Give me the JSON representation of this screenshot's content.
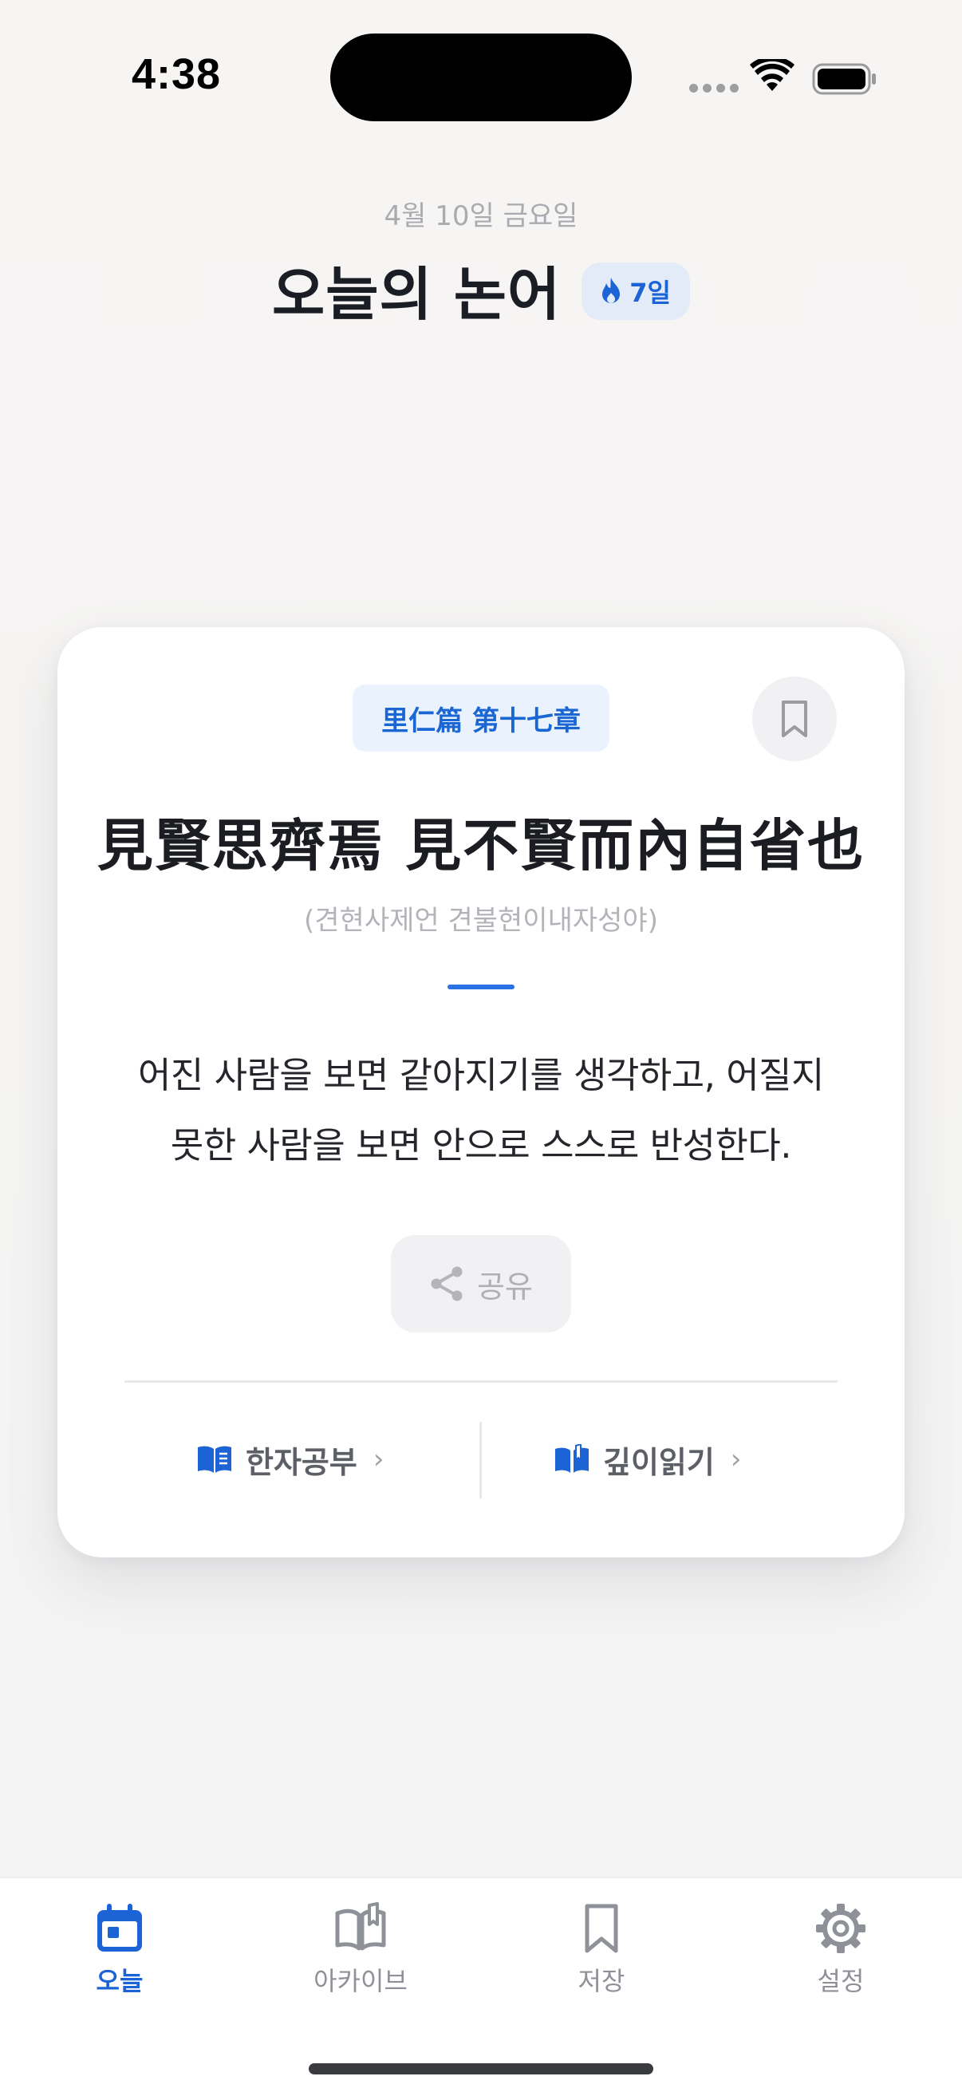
{
  "status_bar": {
    "time": "4:38"
  },
  "header": {
    "date": "4월 10일 금요일",
    "title": "오늘의 논어",
    "streak_label": "7일"
  },
  "card": {
    "chapter": "里仁篇 第十七章",
    "hanja": "見賢思齊焉 見不賢而內自省也",
    "reading": "(견현사제언 견불현이내자성야)",
    "translation": "어진 사람을 보면 같아지기를 생각하고, 어질지 못한 사람을 보면 안으로 스스로 반성한다.",
    "share_label": "공유",
    "study_label": "한자공부",
    "deep_read_label": "깊이읽기"
  },
  "tabs": [
    {
      "label": "오늘",
      "icon": "calendar-icon",
      "active": true
    },
    {
      "label": "아카이브",
      "icon": "book-open-icon",
      "active": false
    },
    {
      "label": "저장",
      "icon": "bookmark-icon",
      "active": false
    },
    {
      "label": "설정",
      "icon": "gear-icon",
      "active": false
    }
  ],
  "colors": {
    "accent": "#1c63d6",
    "background": "#f5f4f3",
    "card": "#ffffff",
    "muted": "#8e9197"
  }
}
